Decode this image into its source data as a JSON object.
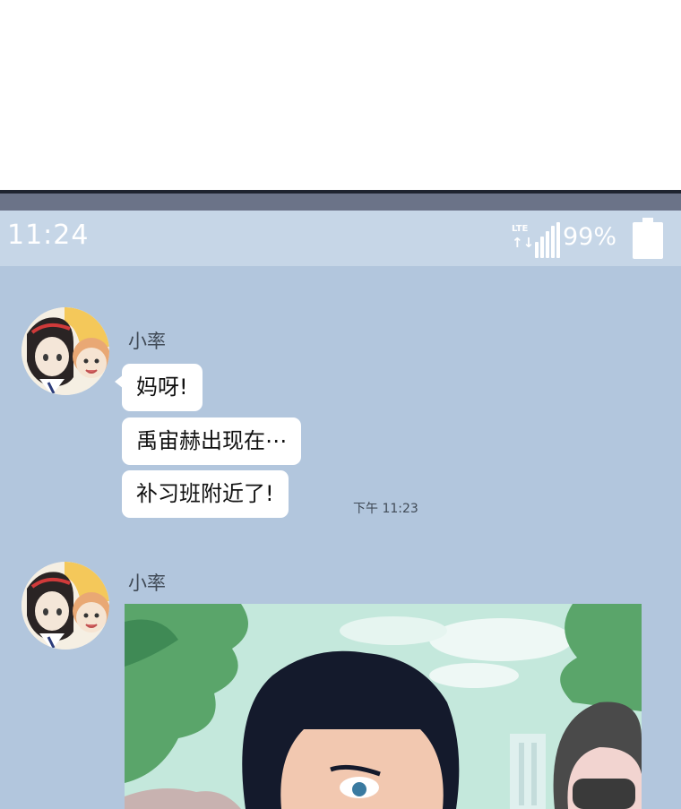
{
  "status_bar": {
    "time": "11:24",
    "network_label": "LTE",
    "network_arrows": "↑↓",
    "battery_percent": "99%",
    "signal_bars": 5
  },
  "messages": [
    {
      "sender": "小率",
      "bubbles": [
        "妈呀!",
        "禹宙赫出现在⋯",
        "补习班附近了!"
      ],
      "timestamp": "下午 11:23"
    },
    {
      "sender": "小率",
      "attachment": "image"
    }
  ],
  "colors": {
    "chat_background": "#b2c6dd",
    "status_bar": "#c6d6e7",
    "bezel": "#6b7388",
    "bubble": "#ffffff"
  }
}
